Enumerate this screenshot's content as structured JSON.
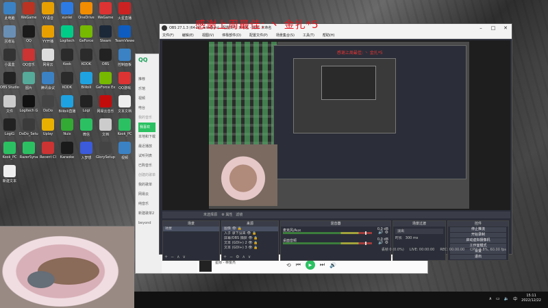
{
  "desktop": {
    "icons": [
      {
        "label": "此电脑",
        "icon": "computer-icon",
        "color": "#3b82c4"
      },
      {
        "label": "WeGame",
        "icon": "game-icon",
        "color": "#b32"
      },
      {
        "label": "YY语音",
        "icon": "yy-icon",
        "color": "#e8a000"
      },
      {
        "label": "xunlei",
        "icon": "bird-icon",
        "color": "#2c7be5"
      },
      {
        "label": "OneDrive",
        "icon": "orange-icon",
        "color": "#f28c00"
      },
      {
        "label": "WeGame",
        "icon": "wegame-icon",
        "color": "#d33"
      },
      {
        "label": "火星直播",
        "icon": "mars-icon",
        "color": "#c22"
      },
      {
        "label": "回收站",
        "icon": "bin-icon",
        "color": "#6a8fb5"
      },
      {
        "label": "QQ",
        "icon": "qq-icon",
        "color": "#1a1a1a"
      },
      {
        "label": "YY开播",
        "icon": "yy-live-icon",
        "color": "#e8a000"
      },
      {
        "label": "Logitech",
        "icon": "logitech-icon",
        "color": "#0c8"
      },
      {
        "label": "GeForce",
        "icon": "nvidia-icon",
        "color": "#76b900"
      },
      {
        "label": "Steam",
        "icon": "steam-icon",
        "color": "#1b2838"
      },
      {
        "label": "TeamViewer",
        "icon": "tv-icon",
        "color": "#0e5cbf"
      },
      {
        "label": "小黑盒",
        "icon": "box-icon",
        "color": "#333"
      },
      {
        "label": "QQ音乐",
        "icon": "music-icon",
        "color": "#c33"
      },
      {
        "label": "网易云",
        "icon": "cloud-icon",
        "color": "#ddd"
      },
      {
        "label": "Kook",
        "icon": "kook-icon",
        "color": "#2b2b2b"
      },
      {
        "label": "KOOK",
        "icon": "kook2-icon",
        "color": "#2b2b2b"
      },
      {
        "label": "OBS",
        "icon": "obs-icon",
        "color": "#222"
      },
      {
        "label": "控制面板",
        "icon": "panel-icon",
        "color": "#3b82c4"
      },
      {
        "label": "OBS Studio",
        "icon": "obs-studio-icon",
        "color": "#222"
      },
      {
        "label": "图片",
        "icon": "picture-icon",
        "color": "#5a9"
      },
      {
        "label": "腾讯会议",
        "icon": "meeting-icon",
        "color": "#3b82c4"
      },
      {
        "label": "KODK",
        "icon": "kodk-icon",
        "color": "#2b2b2b"
      },
      {
        "label": "Bilibili",
        "icon": "bili-icon",
        "color": "#1fa2e0"
      },
      {
        "label": "GeForce Exp",
        "icon": "geforce-icon",
        "color": "#76b900"
      },
      {
        "label": "QQ游戏",
        "icon": "qqgame-icon",
        "color": "#d33"
      },
      {
        "label": "文件",
        "icon": "file-icon",
        "color": "#ccc"
      },
      {
        "label": "Logitech G",
        "icon": "lg-icon",
        "color": "#111"
      },
      {
        "label": "DoDo",
        "icon": "dodo-icon",
        "color": "#444"
      },
      {
        "label": "Bilibili直播",
        "icon": "bililive-icon",
        "color": "#1fa2e0"
      },
      {
        "label": "Logi",
        "icon": "logi-icon",
        "color": "#222"
      },
      {
        "label": "网易云音乐",
        "icon": "netease-icon",
        "color": "#c20c0c"
      },
      {
        "label": "文本文档",
        "icon": "doc-icon",
        "color": "#eee"
      },
      {
        "label": "LogiG",
        "icon": "logig-icon",
        "color": "#222"
      },
      {
        "label": "DoDo_Setup",
        "icon": "dodo-setup-icon",
        "color": "#3b3b3b"
      },
      {
        "label": "Uplay",
        "icon": "uplay-icon",
        "color": "#e8b000"
      },
      {
        "label": "Nuix",
        "icon": "nuix-icon",
        "color": "#3a3"
      },
      {
        "label": "微信",
        "icon": "wechat-icon",
        "color": "#2bc162"
      },
      {
        "label": "文档",
        "icon": "doc2-icon",
        "color": "#ccc"
      },
      {
        "label": "Kook_PC",
        "icon": "kookpc-icon",
        "color": "#2bc162"
      },
      {
        "label": "Kook_PC",
        "icon": "kookpc2-icon",
        "color": "#2bc162"
      },
      {
        "label": "RazerSyna",
        "icon": "razer-icon",
        "color": "#2bc162"
      },
      {
        "label": "Recent Cl",
        "icon": "recent-icon",
        "color": "#c33"
      },
      {
        "label": "Karaoke",
        "icon": "karaoke-icon",
        "color": "#1a1a1a"
      },
      {
        "label": "入梦想",
        "icon": "dream-icon",
        "color": "#3b5bdb"
      },
      {
        "label": "GlorySetup",
        "icon": "glory-icon",
        "color": "#444"
      },
      {
        "label": "视频",
        "icon": "video-icon",
        "color": "#3b82c4"
      },
      {
        "label": "新建文本",
        "icon": "newdoc-icon",
        "color": "#eee"
      }
    ]
  },
  "qq_music": {
    "logo": "QQ",
    "nav": [
      {
        "label": "推荐",
        "section": false,
        "active": false
      },
      {
        "label": "乐馆",
        "section": false,
        "active": false
      },
      {
        "label": "视频",
        "section": false,
        "active": false
      },
      {
        "label": "电台",
        "section": false,
        "active": false
      },
      {
        "label": "我的音乐",
        "section": true,
        "active": false
      },
      {
        "label": "我喜欢",
        "section": false,
        "active": true
      },
      {
        "label": "本地和下载",
        "section": false,
        "active": false
      },
      {
        "label": "最近播放",
        "section": false,
        "active": false
      },
      {
        "label": "试听列表",
        "section": false,
        "active": false
      },
      {
        "label": "已购音乐",
        "section": false,
        "active": false
      },
      {
        "label": "创建的歌单",
        "section": true,
        "active": false
      },
      {
        "label": "我的歌单",
        "section": false,
        "active": false
      },
      {
        "label": "网易云",
        "section": false,
        "active": false
      },
      {
        "label": "纯音乐",
        "section": false,
        "active": false
      },
      {
        "label": "新建歌单2",
        "section": false,
        "active": false
      },
      {
        "label": "beyond",
        "section": false,
        "active": false
      }
    ],
    "player": {
      "song": "星际 - 林俊杰",
      "progress": 0.1
    }
  },
  "overlay": {
    "caption": "感谢上周最佳: 丶 金扎*5"
  },
  "obs": {
    "title": "OBS 27.1.3 (64-bit, windows) - 配置文件: 未命名 - 场景: 未命名",
    "menu": [
      "文件(F)",
      "编辑(E)",
      "视图(V)",
      "停靠部件(D)",
      "配置文件(P)",
      "场景集合(S)",
      "工具(T)",
      "帮助(H)"
    ],
    "preview_caption": "感谢上周最佳: 丶 金扎*5",
    "source_bar": {
      "properties": "属性",
      "filters": "滤镜",
      "label": "未选择源"
    },
    "docks": {
      "scenes": {
        "title": "场景",
        "items": [
          "场景"
        ]
      },
      "sources": {
        "title": "来源",
        "items": [
          "图像",
          "入子 录下没来",
          "屏幕/OBS 捕获",
          "文本 (GDI+) 2",
          "文本 (GDI+) 3"
        ]
      },
      "mixer": {
        "title": "混音器",
        "channels": [
          {
            "name": "麦克风/Aux",
            "level": "0.0 dB",
            "volume": 0.92
          },
          {
            "name": "桌面音频",
            "level": "0.0 dB",
            "volume": 0.92
          }
        ]
      },
      "transitions": {
        "title": "场景过渡",
        "selected": "淡出",
        "duration_label": "时长",
        "duration": "300 ms"
      },
      "controls": {
        "title": "控件",
        "buttons": [
          "停止推流",
          "开始录制",
          "启动虚拟摄像机",
          "工作室模式",
          "设置",
          "退出"
        ]
      }
    },
    "status": {
      "live": "LIVE: 00:00:00",
      "rec": "REC: 00:00:00",
      "cpu": "CPU: 1.8%, 60.00 fps",
      "dropped": "丢帧 0 (0.0%)"
    }
  },
  "taskbar": {
    "time": "15:11",
    "date": "2022/12/22",
    "lang": "中"
  }
}
